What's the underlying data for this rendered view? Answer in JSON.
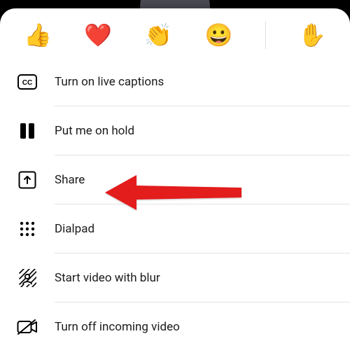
{
  "reactions": {
    "like": "👍",
    "love": "❤️",
    "applause": "👏",
    "laugh": "😀",
    "raise": "✋"
  },
  "menu": {
    "captions": "Turn on live captions",
    "hold": "Put me on hold",
    "share": "Share",
    "dialpad": "Dialpad",
    "blur": "Start video with blur",
    "videoOff": "Turn off incoming video"
  }
}
